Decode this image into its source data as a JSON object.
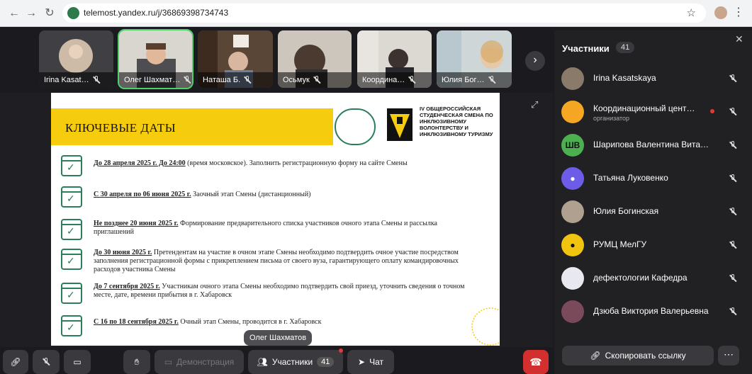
{
  "browser": {
    "url": "telemost.yandex.ru/j/36869398734743"
  },
  "tiles": [
    {
      "name": "Irina Kasat…"
    },
    {
      "name": "Олег Шахмат…"
    },
    {
      "name": "Наташа Б."
    },
    {
      "name": "Осьмук"
    },
    {
      "name": "Координа…"
    },
    {
      "name": "Юлия Бог…"
    }
  ],
  "slide": {
    "title": "КЛЮЧЕВЫЕ ДАТЫ",
    "slogan": "IV ОБЩЕРОССИЙСКАЯ СТУДЕНЧЕСКАЯ СМЕНА ПО ИНКЛЮЗИВНОМУ ВОЛОНТЕРСТВУ И ИНКЛЮЗИВНОМУ ТУРИЗМУ",
    "items": [
      {
        "bold": "До 28 апреля 2025 г. До 24:00",
        "text": " (время московское). Заполнить регистрационную форму на сайте Смены"
      },
      {
        "bold": "С 30 апреля по 06 июня 2025 г.",
        "text": " Заочный этап Смены (дистанционный)"
      },
      {
        "bold": "Не позднее 20 июня 2025 г.",
        "text": " Формирование предварительного списка участников очного этапа Смены и рассылка приглашений"
      },
      {
        "bold": "До 30 июня 2025 г.",
        "text": " Претендентам на участие в очном этапе Смены необходимо подтвердить очное участие посредством заполнения регистрационной формы с прикреплением письма от своего вуза, гарантирующего оплату командировочных расходов участника Смены"
      },
      {
        "bold": "До 7 сентября 2025 г.",
        "text": " Участникам очного этапа Смены необходимо подтвердить свой приезд, уточнить сведения о точном месте, дате, времени прибытия в г. Хабаровск"
      },
      {
        "bold": "С 16 по 18 сентября 2025 г.",
        "text": " Очный этап Смены, проводится в г. Хабаровск"
      }
    ]
  },
  "speaker_label": "Олег Шахматов",
  "toolbar": {
    "demo_label": "Демонстрация",
    "participants_label": "Участники",
    "participants_count": "41",
    "chat_label": "Чат"
  },
  "panel": {
    "title": "Участники",
    "count": "41",
    "participants": [
      {
        "name": "Irina Kasatskaya",
        "role": "",
        "initials": "",
        "color": "#8a7a6a"
      },
      {
        "name": "Координационный цент…",
        "role": "организатор",
        "initials": "",
        "color": "#f5a623"
      },
      {
        "name": "Шарипова Валентина Вита…",
        "role": "",
        "initials": "ШВ",
        "color": "#4caf50"
      },
      {
        "name": "Татьяна Луковенко",
        "role": "",
        "initials": "",
        "color": "#6c5ce7"
      },
      {
        "name": "Юлия Богинская",
        "role": "",
        "initials": "",
        "color": "#b0a090"
      },
      {
        "name": "РУМЦ МелГУ",
        "role": "",
        "initials": "",
        "color": "#f1c40f"
      },
      {
        "name": "дефектологии Кафедра",
        "role": "",
        "initials": "",
        "color": "#e8e8f0"
      },
      {
        "name": "Дзюба Виктория Валерьевна",
        "role": "",
        "initials": "",
        "color": "#7a4a5a"
      }
    ],
    "copy_label": "Скопировать ссылку"
  }
}
